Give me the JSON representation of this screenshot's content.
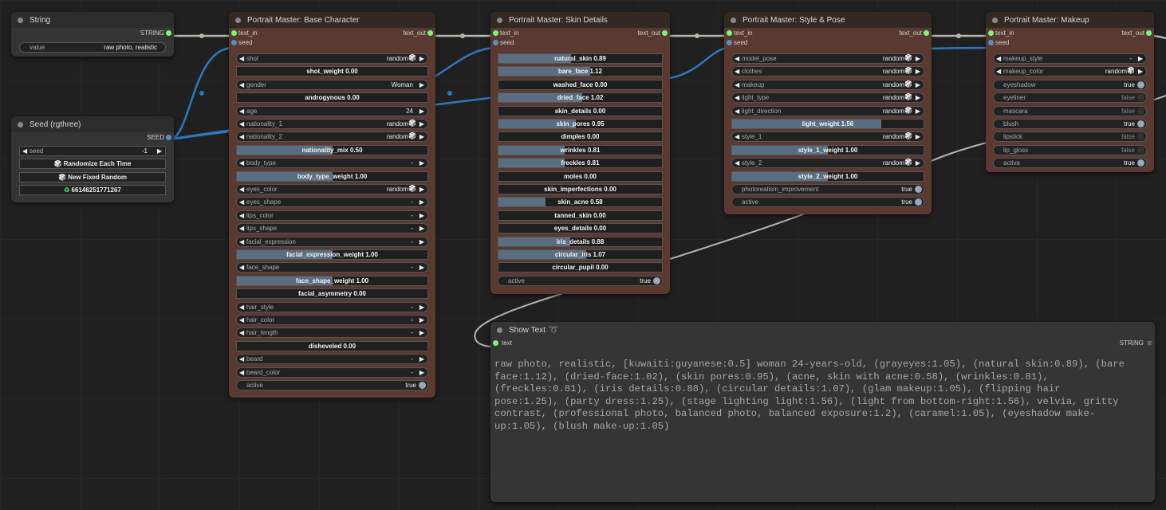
{
  "colors": {
    "accent": "#7bf77b",
    "link_blue": "#2e77c0",
    "link_gray": "#b3b8a8",
    "slider_fill": "#5a6e82"
  },
  "string_node": {
    "title": "String",
    "out_label": "STRING",
    "value_label": "value",
    "value": "raw photo, realistic"
  },
  "seed_node": {
    "title": "Seed (rgthree)",
    "out_label": "SEED",
    "seed_label": "seed",
    "seed_value": "-1",
    "buttons": [
      "Randomize Each Time",
      "New Fixed Random",
      "66146251771267"
    ]
  },
  "base_node": {
    "title": "Portrait Master: Base Character",
    "in_label": "text_in",
    "out_label": "text_out",
    "seed_label": "seed",
    "widgets": [
      {
        "kind": "combo",
        "label": "shot",
        "value": "random",
        "dice": true
      },
      {
        "kind": "slider",
        "label": "shot_weight",
        "value": "0.00",
        "fill": 0
      },
      {
        "kind": "combo",
        "label": "gender",
        "value": "Woman",
        "dice": false
      },
      {
        "kind": "slider",
        "label": "androgynous",
        "value": "0.00",
        "fill": 0
      },
      {
        "kind": "combo",
        "label": "age",
        "value": "24",
        "dice": false
      },
      {
        "kind": "combo",
        "label": "nationality_1",
        "value": "random",
        "dice": true
      },
      {
        "kind": "combo",
        "label": "nationality_2",
        "value": "random",
        "dice": true
      },
      {
        "kind": "slider",
        "label": "nationality_mix",
        "value": "0.50",
        "fill": 0.5
      },
      {
        "kind": "combo",
        "label": "body_type",
        "value": "-",
        "dice": false
      },
      {
        "kind": "slider",
        "label": "body_type_weight",
        "value": "1.00",
        "fill": 0.5
      },
      {
        "kind": "combo",
        "label": "eyes_color",
        "value": "random",
        "dice": true
      },
      {
        "kind": "combo",
        "label": "eyes_shape",
        "value": "-",
        "dice": false
      },
      {
        "kind": "combo",
        "label": "lips_color",
        "value": "-",
        "dice": false
      },
      {
        "kind": "combo",
        "label": "lips_shape",
        "value": "-",
        "dice": false
      },
      {
        "kind": "combo",
        "label": "facial_expression",
        "value": "-",
        "dice": false
      },
      {
        "kind": "slider",
        "label": "facial_expression_weight",
        "value": "1.00",
        "fill": 0.5
      },
      {
        "kind": "combo",
        "label": "face_shape",
        "value": "-",
        "dice": false
      },
      {
        "kind": "slider",
        "label": "face_shape_weight",
        "value": "1.00",
        "fill": 0.5
      },
      {
        "kind": "slider",
        "label": "facial_asymmetry",
        "value": "0.00",
        "fill": 0
      },
      {
        "kind": "combo",
        "label": "hair_style",
        "value": "-",
        "dice": false
      },
      {
        "kind": "combo",
        "label": "hair_color",
        "value": "-",
        "dice": false
      },
      {
        "kind": "combo",
        "label": "hair_length",
        "value": "-",
        "dice": false
      },
      {
        "kind": "slider",
        "label": "disheveled",
        "value": "0.00",
        "fill": 0
      },
      {
        "kind": "combo",
        "label": "beard",
        "value": "-",
        "dice": false
      },
      {
        "kind": "combo",
        "label": "beard_color",
        "value": "-",
        "dice": false
      },
      {
        "kind": "toggle",
        "label": "active",
        "value": "true",
        "on": true
      }
    ]
  },
  "skin_node": {
    "title": "Portrait Master: Skin Details",
    "in_label": "text_in",
    "out_label": "text_out",
    "seed_label": "seed",
    "widgets": [
      {
        "kind": "slider",
        "label": "natural_skin",
        "value": "0.89",
        "fill": 0.445
      },
      {
        "kind": "slider",
        "label": "bare_face",
        "value": "1.12",
        "fill": 0.56
      },
      {
        "kind": "slider",
        "label": "washed_face",
        "value": "0.00",
        "fill": 0
      },
      {
        "kind": "slider",
        "label": "dried_face",
        "value": "1.02",
        "fill": 0.51
      },
      {
        "kind": "slider",
        "label": "skin_details",
        "value": "0.00",
        "fill": 0
      },
      {
        "kind": "slider",
        "label": "skin_pores",
        "value": "0.95",
        "fill": 0.475
      },
      {
        "kind": "slider",
        "label": "dimples",
        "value": "0.00",
        "fill": 0
      },
      {
        "kind": "slider",
        "label": "wrinkles",
        "value": "0.81",
        "fill": 0.405
      },
      {
        "kind": "slider",
        "label": "freckles",
        "value": "0.81",
        "fill": 0.405
      },
      {
        "kind": "slider",
        "label": "moles",
        "value": "0.00",
        "fill": 0
      },
      {
        "kind": "slider",
        "label": "skin_imperfections",
        "value": "0.00",
        "fill": 0
      },
      {
        "kind": "slider",
        "label": "skin_acne",
        "value": "0.58",
        "fill": 0.29
      },
      {
        "kind": "slider",
        "label": "tanned_skin",
        "value": "0.00",
        "fill": 0
      },
      {
        "kind": "slider",
        "label": "eyes_details",
        "value": "0.00",
        "fill": 0
      },
      {
        "kind": "slider",
        "label": "iris_details",
        "value": "0.88",
        "fill": 0.44
      },
      {
        "kind": "slider",
        "label": "circular_iris",
        "value": "1.07",
        "fill": 0.535
      },
      {
        "kind": "slider",
        "label": "circular_pupil",
        "value": "0.00",
        "fill": 0
      },
      {
        "kind": "toggle",
        "label": "active",
        "value": "true",
        "on": true
      }
    ]
  },
  "style_node": {
    "title": "Portrait Master: Style & Pose",
    "in_label": "text_in",
    "out_label": "text_out",
    "seed_label": "seed",
    "widgets": [
      {
        "kind": "combo",
        "label": "model_pose",
        "value": "random",
        "dice": true
      },
      {
        "kind": "combo",
        "label": "clothes",
        "value": "random",
        "dice": true
      },
      {
        "kind": "combo",
        "label": "makeup",
        "value": "random",
        "dice": true
      },
      {
        "kind": "combo",
        "label": "light_type",
        "value": "random",
        "dice": true
      },
      {
        "kind": "combo",
        "label": "light_direction",
        "value": "random",
        "dice": true
      },
      {
        "kind": "slider",
        "label": "light_weight",
        "value": "1.56",
        "fill": 0.78
      },
      {
        "kind": "combo",
        "label": "style_1",
        "value": "random",
        "dice": true
      },
      {
        "kind": "slider",
        "label": "style_1_weight",
        "value": "1.00",
        "fill": 0.5
      },
      {
        "kind": "combo",
        "label": "style_2",
        "value": "random",
        "dice": true
      },
      {
        "kind": "slider",
        "label": "style_2_weight",
        "value": "1.00",
        "fill": 0.5
      },
      {
        "kind": "toggle",
        "label": "photorealism_improvement",
        "value": "true",
        "on": true
      },
      {
        "kind": "toggle",
        "label": "active",
        "value": "true",
        "on": true
      }
    ]
  },
  "makeup_node": {
    "title": "Portrait Master: Makeup",
    "in_label": "text_in",
    "out_label": "text_out",
    "seed_label": "seed",
    "widgets": [
      {
        "kind": "combo",
        "label": "makeup_style",
        "value": "-",
        "dice": false
      },
      {
        "kind": "combo",
        "label": "makeup_color",
        "value": "random",
        "dice": true
      },
      {
        "kind": "toggle",
        "label": "eyeshadow",
        "value": "true",
        "on": true
      },
      {
        "kind": "toggle",
        "label": "eyeliner",
        "value": "false",
        "on": false
      },
      {
        "kind": "toggle",
        "label": "mascara",
        "value": "false",
        "on": false
      },
      {
        "kind": "toggle",
        "label": "blush",
        "value": "true",
        "on": true
      },
      {
        "kind": "toggle",
        "label": "lipstick",
        "value": "false",
        "on": false
      },
      {
        "kind": "toggle",
        "label": "lip_gloss",
        "value": "false",
        "on": false
      },
      {
        "kind": "toggle",
        "label": "active",
        "value": "true",
        "on": true
      }
    ]
  },
  "show_text": {
    "title": "Show Text",
    "in_label": "text",
    "out_label": "STRING",
    "text": "raw photo, realistic, [kuwaiti:guyanese:0.5] woman 24-years-old, (grayeyes:1.05), (natural skin:0.89), (bare\nface:1.12), (dried-face:1.02), (skin pores:0.95), (acne, skin with acne:0.58), (wrinkles:0.81),\n(freckles:0.81), (iris details:0.88), (circular details:1.07), (glam makeup:1.05), (flipping hair\npose:1.25), (party dress:1.25), (stage lighting light:1.56), (light from bottom-right:1.56), velvia, gritty\ncontrast, (professional photo, balanced photo, balanced exposure:1.2), (caramel:1.05), (eyeshadow make-\nup:1.05), (blush make-up:1.05)"
  }
}
